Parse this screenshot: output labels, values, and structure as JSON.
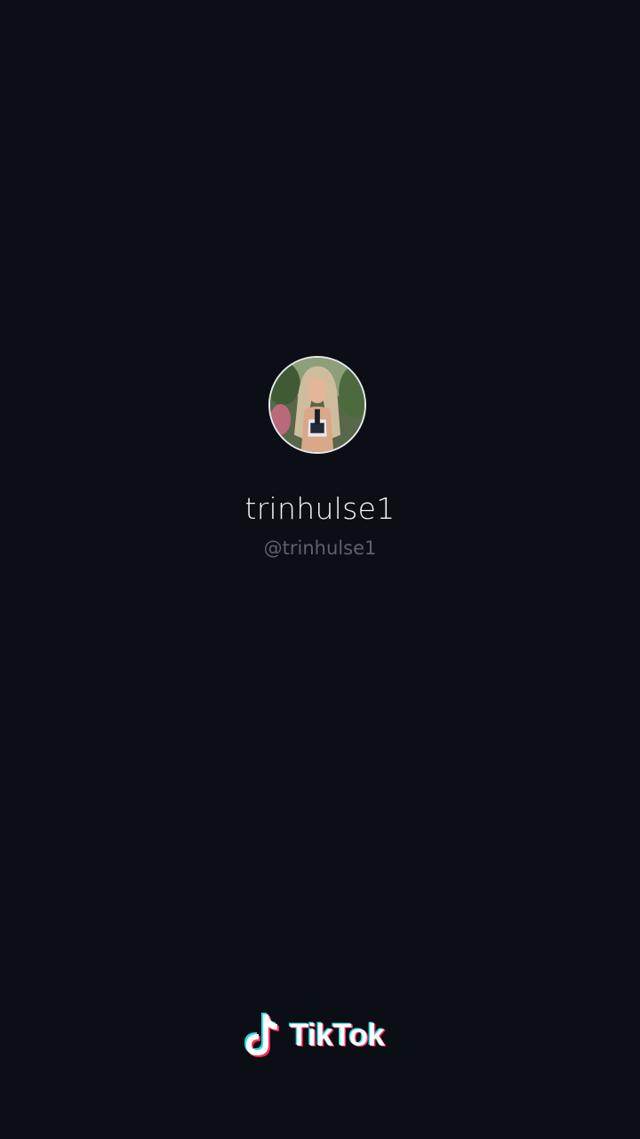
{
  "profile": {
    "display_name": "trinhulse1",
    "handle": "@trinhulse1",
    "avatar_icon": "profile-photo"
  },
  "watermark": {
    "brand": "TikTok",
    "icon": "tiktok-note-icon"
  },
  "colors": {
    "background": "#0b0e15",
    "display_name": "#f2f2f4",
    "handle": "#5e616a",
    "brand_cyan": "#22e0e6",
    "brand_red": "#fe2c55"
  }
}
